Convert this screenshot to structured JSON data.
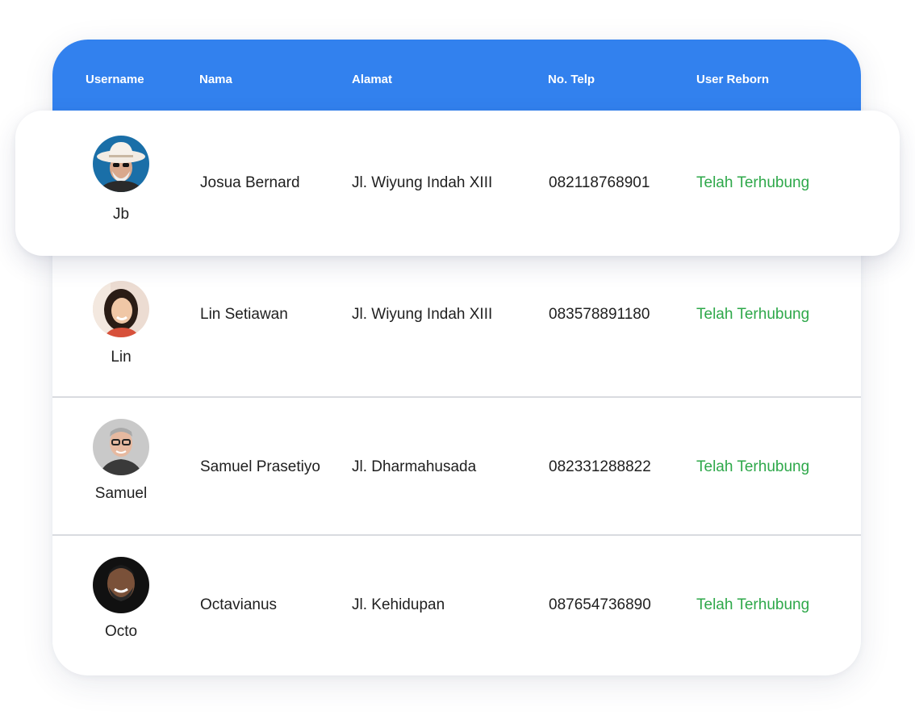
{
  "table": {
    "headers": {
      "username": "Username",
      "nama": "Nama",
      "alamat": "Alamat",
      "telp": "No. Telp",
      "reborn": "User Reborn"
    },
    "rows": [
      {
        "username": "Jb",
        "nama": "Josua Bernard",
        "alamat": "Jl. Wiyung Indah XIII",
        "telp": "082118768901",
        "status": "Telah Terhubung",
        "avatar_icon": "avatar-man-white-hat"
      },
      {
        "username": "Lin",
        "nama": "Lin Setiawan",
        "alamat": "Jl. Wiyung Indah XIII",
        "telp": "083578891180",
        "status": "Telah Terhubung",
        "avatar_icon": "avatar-woman-smiling"
      },
      {
        "username": "Samuel",
        "nama": "Samuel Prasetiyo",
        "alamat": "Jl. Dharmahusada",
        "telp": "082331288822",
        "status": "Telah Terhubung",
        "avatar_icon": "avatar-man-glasses"
      },
      {
        "username": "Octo",
        "nama": "Octavianus",
        "alamat": "Jl. Kehidupan",
        "telp": "087654736890",
        "status": "Telah Terhubung",
        "avatar_icon": "avatar-man-beard"
      }
    ]
  },
  "colors": {
    "header_bg": "#3281ee",
    "status_green": "#2ea84a",
    "divider": "#d9dbe0"
  }
}
